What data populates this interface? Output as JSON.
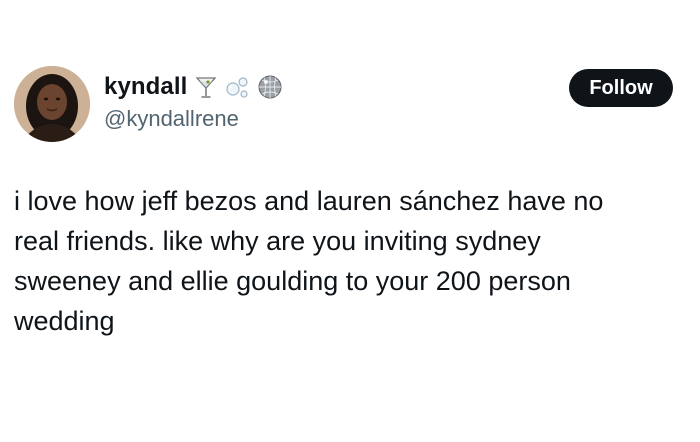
{
  "author": {
    "display_name": "kyndall",
    "handle": "@kyndallrene",
    "name_emojis": [
      "martini-glass-icon",
      "bubbles-icon",
      "disco-ball-icon"
    ]
  },
  "follow_button": {
    "label": "Follow",
    "background": "#0f1419",
    "text_color": "#ffffff"
  },
  "tweet": {
    "text": "i love how jeff bezos and lauren sánchez have no\nreal friends. like why are you inviting sydney\nsweeney and ellie goulding to your 200 person\nwedding"
  },
  "colors": {
    "text_primary": "#0f1419",
    "text_secondary": "#536471",
    "background": "#ffffff"
  }
}
